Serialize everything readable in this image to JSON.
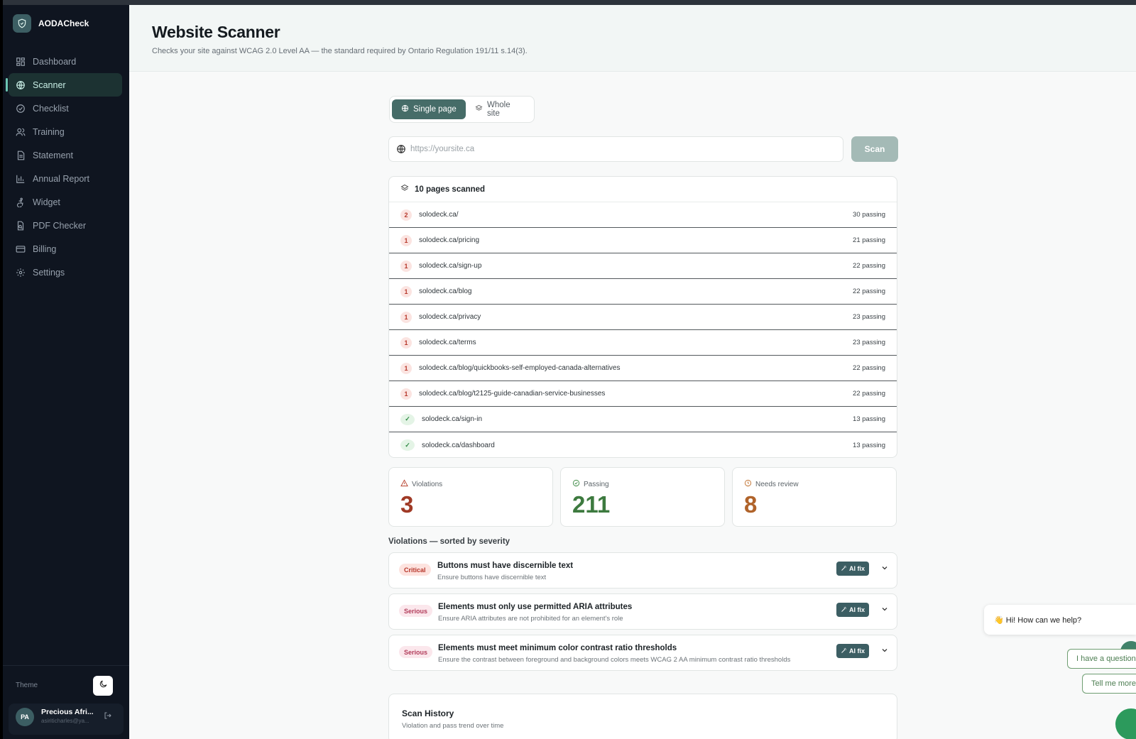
{
  "app": {
    "name": "AODACheck"
  },
  "sidebar": {
    "items": [
      {
        "label": "Dashboard",
        "icon": "dashboard-icon"
      },
      {
        "label": "Scanner",
        "icon": "globe-icon",
        "active": true
      },
      {
        "label": "Checklist",
        "icon": "check-circle-icon"
      },
      {
        "label": "Training",
        "icon": "users-icon"
      },
      {
        "label": "Statement",
        "icon": "document-icon"
      },
      {
        "label": "Annual Report",
        "icon": "bar-chart-icon"
      },
      {
        "label": "Widget",
        "icon": "accessibility-icon"
      },
      {
        "label": "PDF Checker",
        "icon": "file-search-icon"
      },
      {
        "label": "Billing",
        "icon": "credit-card-icon"
      },
      {
        "label": "Settings",
        "icon": "gear-icon"
      }
    ],
    "theme_label": "Theme",
    "user": {
      "initials": "PA",
      "name": "Precious Afri...",
      "email": "asiriticharles@ya..."
    }
  },
  "header": {
    "title": "Website Scanner",
    "subtitle": "Checks your site against WCAG 2.0 Level AA — the standard required by Ontario Regulation 191/11 s.14(3)."
  },
  "mode": {
    "single": "Single page",
    "whole": "Whole site",
    "selected": "Single page"
  },
  "scan": {
    "placeholder": "https://yoursite.ca",
    "button": "Scan"
  },
  "pages": {
    "summary": "10 pages scanned",
    "rows": [
      {
        "badge": "2",
        "status": "violation",
        "url": "solodeck.ca/",
        "passing": "30 passing"
      },
      {
        "badge": "1",
        "status": "violation",
        "url": "solodeck.ca/pricing",
        "passing": "21 passing"
      },
      {
        "badge": "1",
        "status": "violation",
        "url": "solodeck.ca/sign-up",
        "passing": "22 passing"
      },
      {
        "badge": "1",
        "status": "violation",
        "url": "solodeck.ca/blog",
        "passing": "22 passing"
      },
      {
        "badge": "1",
        "status": "violation",
        "url": "solodeck.ca/privacy",
        "passing": "23 passing"
      },
      {
        "badge": "1",
        "status": "violation",
        "url": "solodeck.ca/terms",
        "passing": "23 passing"
      },
      {
        "badge": "1",
        "status": "violation",
        "url": "solodeck.ca/blog/quickbooks-self-employed-canada-alternatives",
        "passing": "22 passing"
      },
      {
        "badge": "1",
        "status": "violation",
        "url": "solodeck.ca/blog/t2125-guide-canadian-service-businesses",
        "passing": "22 passing"
      },
      {
        "badge": "✓",
        "status": "ok",
        "url": "solodeck.ca/sign-in",
        "passing": "13 passing"
      },
      {
        "badge": "✓",
        "status": "ok",
        "url": "solodeck.ca/dashboard",
        "passing": "13 passing"
      }
    ]
  },
  "stats": {
    "violations": {
      "label": "Violations",
      "value": "3",
      "color": "#a03a26"
    },
    "passing": {
      "label": "Passing",
      "value": "211",
      "color": "#3d7a3f"
    },
    "review": {
      "label": "Needs review",
      "value": "8",
      "color": "#b0632a"
    }
  },
  "violations": {
    "heading": "Violations — sorted by severity",
    "items": [
      {
        "severity": "Critical",
        "title": "Buttons must have discernible text",
        "desc": "Ensure buttons have discernible text",
        "fix": "AI fix"
      },
      {
        "severity": "Serious",
        "title": "Elements must only use permitted ARIA attributes",
        "desc": "Ensure ARIA attributes are not prohibited for an element's role",
        "fix": "AI fix"
      },
      {
        "severity": "Serious",
        "title": "Elements must meet minimum color contrast ratio thresholds",
        "desc": "Ensure the contrast between foreground and background colors meets WCAG 2 AA minimum contrast ratio thresholds",
        "fix": "AI fix"
      }
    ]
  },
  "history": {
    "title": "Scan History",
    "subtitle": "Violation and pass trend over time"
  },
  "chat": {
    "greeting": "👋 Hi! How can we help?",
    "options": [
      "I have a question",
      "Tell me more"
    ]
  },
  "colors": {
    "accent": "#466c68",
    "sidebar_bg": "#0f1520",
    "scan_button": "#a4bab6"
  }
}
